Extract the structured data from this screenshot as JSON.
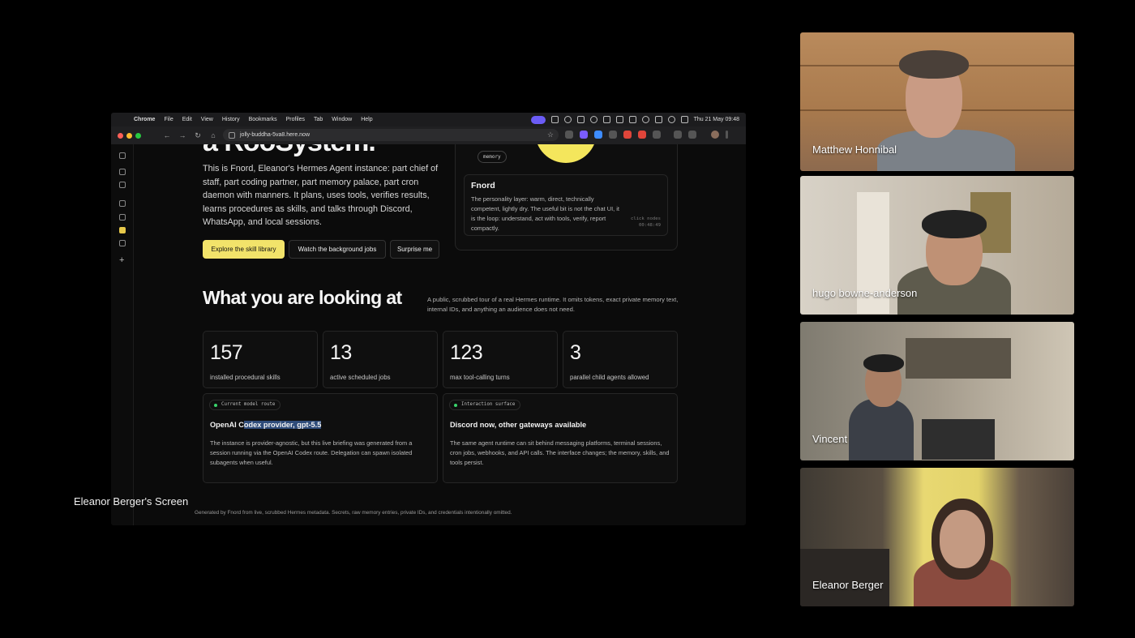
{
  "mac_menubar": {
    "menus": [
      "Chrome",
      "File",
      "Edit",
      "View",
      "History",
      "Bookmarks",
      "Profiles",
      "Tab",
      "Window",
      "Help"
    ],
    "datetime": "Thu 21 May  09:48"
  },
  "browser": {
    "url": "jolly-buddha-5va8.here.now"
  },
  "page": {
    "hero_title_fragment": "a RooSystem.",
    "hero_description": "This is Fnord, Eleanor's Hermes Agent instance: part chief of staff, part coding partner, part memory palace, part cron daemon with manners. It plans, uses tools, verifies results, learns procedures as skills, and talks through Discord, WhatsApp, and local sessions.",
    "buttons": {
      "explore": "Explore the skill library",
      "watch": "Watch the background jobs",
      "surprise": "Surprise me"
    },
    "persona": {
      "chip": "memory",
      "title": "Fnord",
      "description": "The personality layer: warm, direct, technically competent, lightly dry. The useful bit is not the chat UI, it is the loop: understand, act with tools, verify, report compactly.",
      "hint": "click nodes",
      "hint_time": "00:48:49"
    },
    "section_title": "What you are looking at",
    "section_description": "A public, scrubbed tour of a real Hermes runtime. It omits tokens, exact private memory text, internal IDs, and anything an audience does not need.",
    "stats": [
      {
        "value": "157",
        "label": "installed procedural skills"
      },
      {
        "value": "13",
        "label": "active scheduled jobs"
      },
      {
        "value": "123",
        "label": "max tool-calling turns"
      },
      {
        "value": "3",
        "label": "parallel child agents allowed"
      }
    ],
    "model_card": {
      "tag": "Current model route",
      "title_plain": "OpenAI C",
      "title_highlight": "odex provider, gpt-5.5",
      "body": "The instance is provider-agnostic, but this live briefing was generated from a session running via the OpenAI Codex route. Delegation can spawn isolated subagents when useful."
    },
    "surface_card": {
      "tag": "Interaction surface",
      "title": "Discord now, other gateways available",
      "body": "The same agent runtime can sit behind messaging platforms, terminal sessions, cron jobs, webhooks, and API calls. The interface changes; the memory, skills, and tools persist."
    },
    "footer": "Generated by Fnord from live, scrubbed Hermes metadata. Secrets, raw memory entries, private IDs, and credentials intentionally omitted."
  },
  "screen_share_label": "Eleanor Berger's Screen",
  "participants": [
    {
      "name": "Matthew Honnibal"
    },
    {
      "name": "hugo bowne-anderson"
    },
    {
      "name": "Vincent"
    },
    {
      "name": "Eleanor Berger"
    }
  ],
  "colors": {
    "accent_yellow": "#f2e36a",
    "highlight_blue": "#2f4c7a",
    "status_green": "#39d36b",
    "menubar_pill": "#6b5cf6"
  }
}
